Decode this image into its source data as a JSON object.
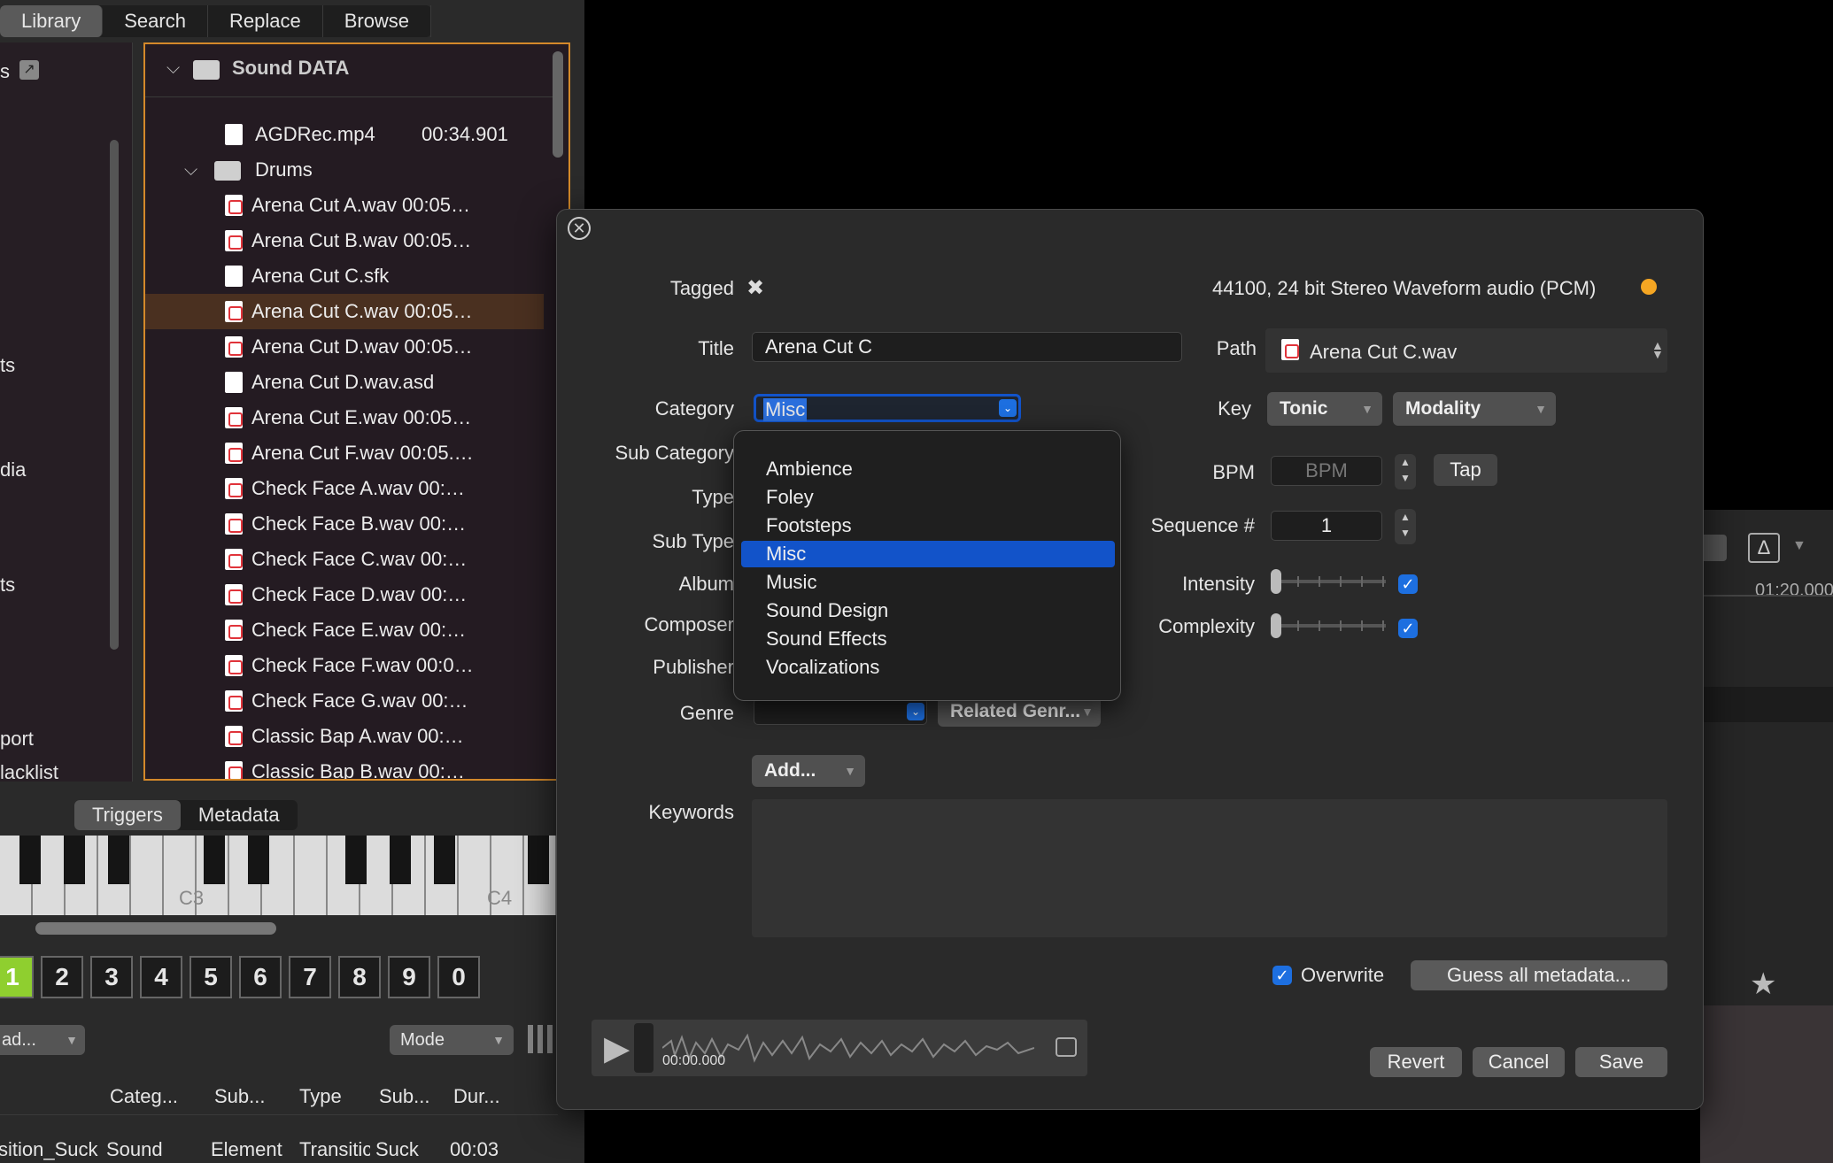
{
  "top_tabs": [
    "Library",
    "Search",
    "Replace",
    "Browse"
  ],
  "sidebar": {
    "items": [
      {
        "label": "s"
      },
      {
        "label": "ts"
      },
      {
        "label": "dia"
      },
      {
        "label": "ts"
      },
      {
        "label": "port"
      },
      {
        "label": "lacklist"
      }
    ]
  },
  "tree": {
    "root_folder": "Sound DATA",
    "top_file": {
      "name": "AGDRec.mp4",
      "duration": "00:34.901"
    },
    "sub_folder": "Drums",
    "files": [
      "Arena Cut A.wav 00:05…",
      "Arena Cut B.wav 00:05…",
      "Arena Cut C.sfk",
      "Arena Cut C.wav 00:05…",
      "Arena Cut D.wav 00:05…",
      "Arena Cut D.wav.asd",
      "Arena Cut E.wav 00:05…",
      "Arena Cut F.wav 00:05.…",
      "Check Face A.wav  00:…",
      "Check Face B.wav  00:…",
      "Check Face C.wav  00:…",
      "Check Face D.wav  00:…",
      "Check Face E.wav  00:…",
      "Check Face F.wav 00:0…",
      "Check Face G.wav  00:…",
      "Classic Bap A.wav  00:…",
      "Classic Bap B.wav  00:…"
    ],
    "selected_index": 3
  },
  "bottom": {
    "tabs": [
      "Triggers",
      "Metadata"
    ],
    "keyboard_labels": [
      "C3",
      "C4"
    ],
    "pads": [
      "1",
      "2",
      "3",
      "4",
      "5",
      "6",
      "7",
      "8",
      "9",
      "0"
    ],
    "load_label": "ad...",
    "mode_label": "Mode",
    "table_headers": [
      "Categ...",
      "Sub...",
      "Type",
      "Sub...",
      "Dur..."
    ],
    "table_row": [
      "sition_Suck",
      "Sound",
      "Element",
      "Transitic",
      "Suck",
      "00:03"
    ]
  },
  "timeline": {
    "time_label": "01:20.000"
  },
  "dialog": {
    "tagged_label": "Tagged",
    "format_info": "44100, 24 bit Stereo Waveform audio (PCM)",
    "title_label": "Title",
    "title_value": "Arena Cut C",
    "path_label": "Path",
    "path_value": "Arena Cut C.wav",
    "category_label": "Category",
    "category_value": "Misc",
    "category_options": [
      "Ambience",
      "Foley",
      "Footsteps",
      "Misc",
      "Music",
      "Sound Design",
      "Sound Effects",
      "Vocalizations"
    ],
    "sub_category_label": "Sub Category",
    "type_label": "Type",
    "sub_type_label": "Sub Type",
    "album_label": "Album",
    "composer_label": "Composer",
    "publisher_label": "Publisher",
    "genre_label": "Genre",
    "related_genre_label": "Related Genr...",
    "key_label": "Key",
    "tonic_label": "Tonic",
    "modality_label": "Modality",
    "bpm_label": "BPM",
    "bpm_placeholder": "BPM",
    "tap_label": "Tap",
    "sequence_label": "Sequence #",
    "sequence_value": "1",
    "intensity_label": "Intensity",
    "complexity_label": "Complexity",
    "add_label": "Add...",
    "keywords_label": "Keywords",
    "overwrite_label": "Overwrite",
    "guess_label": "Guess all metadata...",
    "time_readout": "00:00.000",
    "revert_label": "Revert",
    "cancel_label": "Cancel",
    "save_label": "Save"
  },
  "colors": {
    "accent_blue": "#1253c9",
    "selection_orange": "#d4892a",
    "status_dot": "#f5a623",
    "pad_active": "#8fcf2f"
  }
}
